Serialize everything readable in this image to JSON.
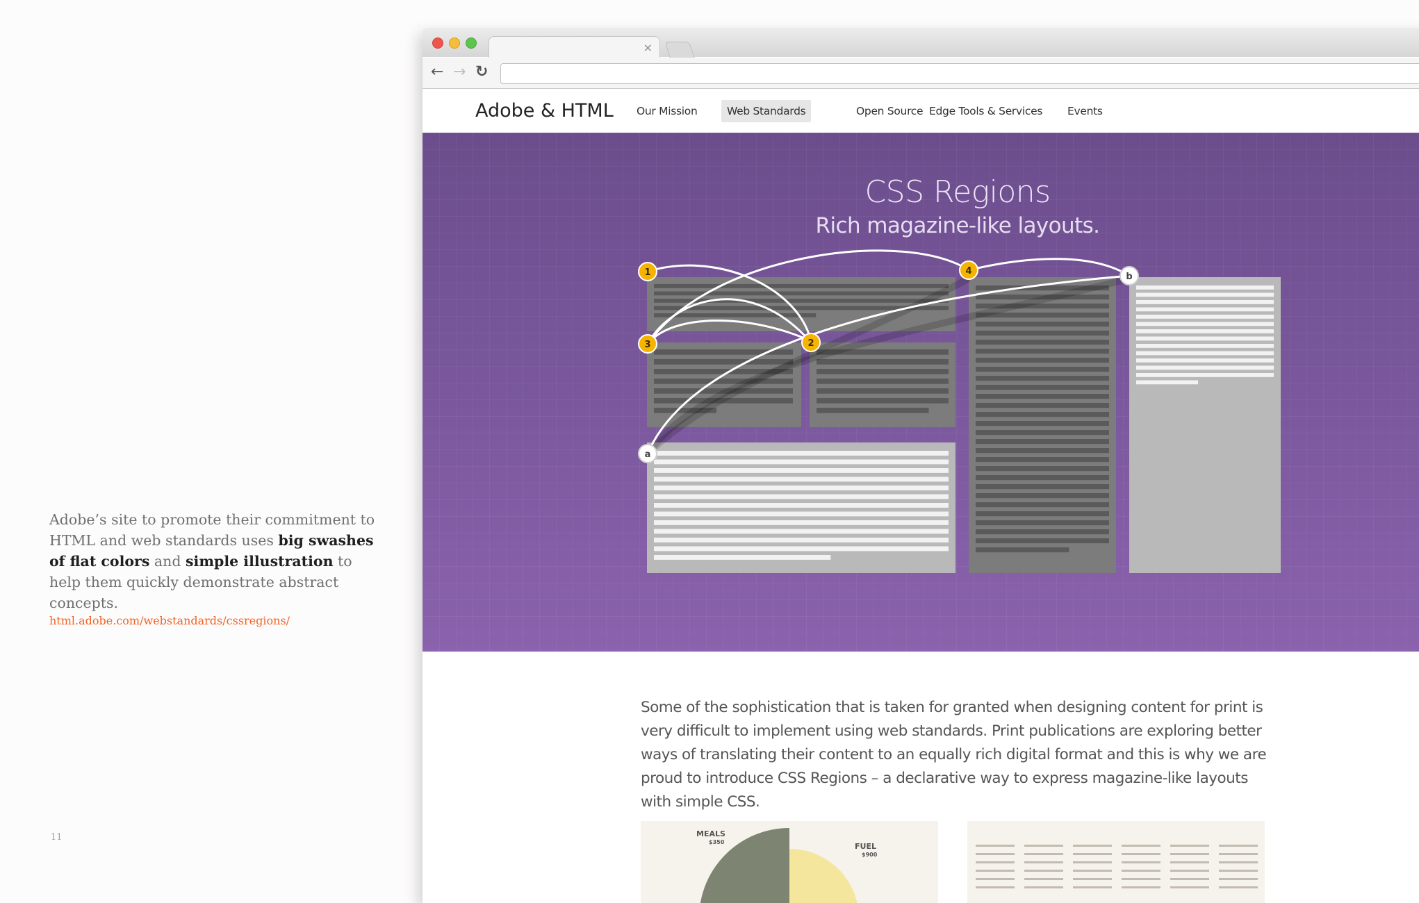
{
  "caption": {
    "parts": [
      {
        "text": "Adobe’s site to promote their commitment to HTML and web standards uses ",
        "bold": false
      },
      {
        "text": "big swashes of flat colors",
        "bold": true
      },
      {
        "text": " and ",
        "bold": false
      },
      {
        "text": "simple illustration",
        "bold": true
      },
      {
        "text": " to help them quickly demonstrate abstract concepts.",
        "bold": false
      }
    ],
    "link": "html.adobe.com/webstandards/cssregions/",
    "page_number": "11"
  },
  "browser": {
    "tab_close_icon": "close-icon",
    "back_icon": "back-arrow-icon",
    "forward_icon": "forward-arrow-icon",
    "reload_icon": "reload-icon",
    "address": ""
  },
  "site": {
    "logo": "Adobe & HTML",
    "nav": [
      {
        "label": "Our Mission",
        "active": false
      },
      {
        "label": "Web Standards",
        "active": true
      },
      {
        "label": "Open Source",
        "active": false
      },
      {
        "label": "Edge Tools & Services",
        "active": false
      },
      {
        "label": "Events",
        "active": false
      }
    ],
    "brand_color": "#e31e24"
  },
  "hero": {
    "title": "CSS Regions",
    "subtitle": "Rich magazine-like layouts.",
    "background": "#7a569e",
    "markers": [
      {
        "label": "1",
        "color": "#f5b400"
      },
      {
        "label": "2",
        "color": "#f5b400"
      },
      {
        "label": "3",
        "color": "#f5b400"
      },
      {
        "label": "4",
        "color": "#f5b400"
      },
      {
        "label": "a",
        "color": "#ffffff"
      },
      {
        "label": "b",
        "color": "#ffffff"
      }
    ]
  },
  "intro": "Some of the sophistication that is taken for granted when designing content for print is very difficult to implement using web standards. Print publications are exploring better ways of translating their content to an equally rich digital format and this is why we are proud to introduce CSS Regions – a declarative way to express magazine-like layouts with simple CSS.",
  "thumbs": {
    "first": {
      "meals": "MEALS",
      "meals_amount": "$350",
      "fuel": "FUEL",
      "fuel_amount": "$900"
    }
  }
}
